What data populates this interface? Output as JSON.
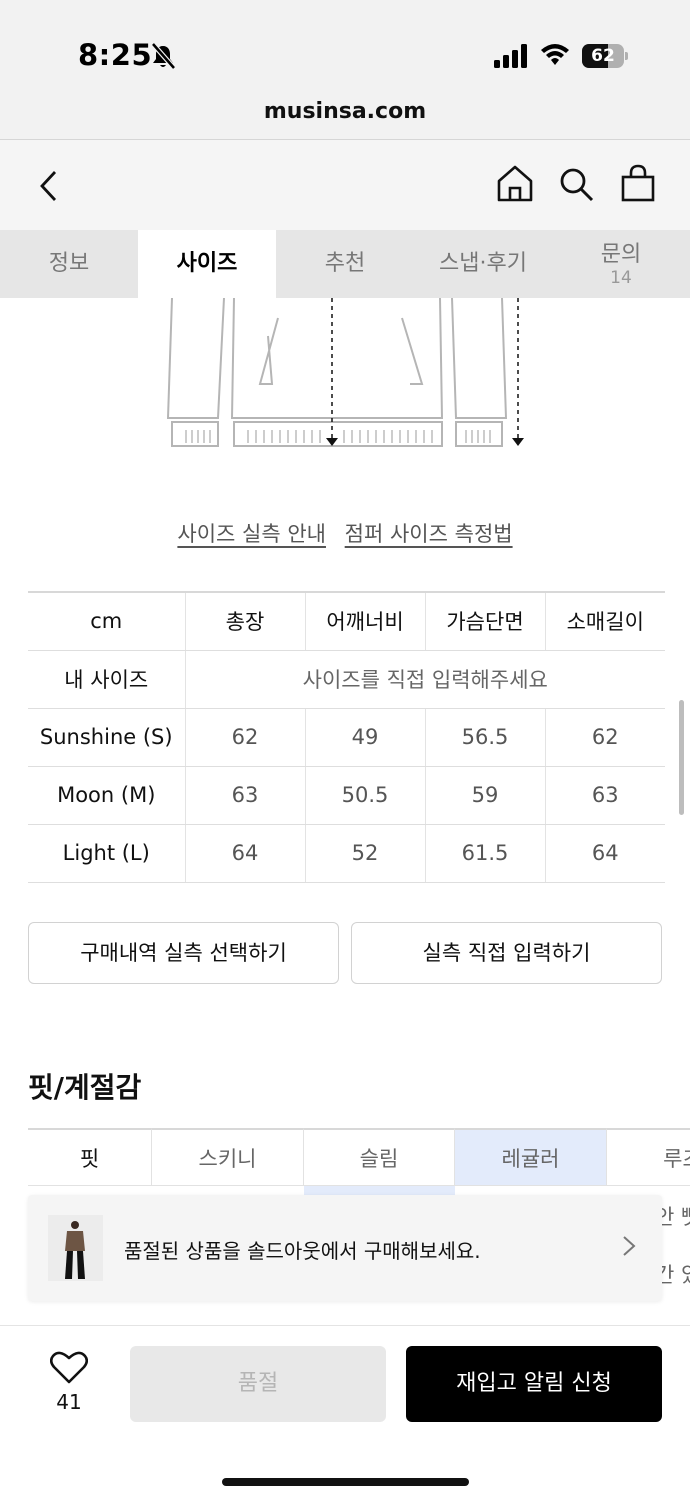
{
  "status_bar": {
    "time": "8:25",
    "battery": "62",
    "battery_level": 0.62
  },
  "browser": {
    "url": "musinsa.com"
  },
  "tabs": [
    {
      "label": "정보",
      "sub": ""
    },
    {
      "label": "사이즈",
      "sub": ""
    },
    {
      "label": "추천",
      "sub": ""
    },
    {
      "label": "스냅·후기",
      "sub": ""
    },
    {
      "label": "문의",
      "sub": "14"
    }
  ],
  "size_guide_links": [
    "사이즈 실측 안내",
    "점퍼 사이즈 측정법"
  ],
  "size_table": {
    "unit": "cm",
    "columns": [
      "총장",
      "어깨너비",
      "가슴단면",
      "소매길이"
    ],
    "my_size_label": "내 사이즈",
    "my_size_hint": "사이즈를 직접 입력해주세요",
    "rows": [
      {
        "size": "Sunshine (S)",
        "values": [
          "62",
          "49",
          "56.5",
          "62"
        ]
      },
      {
        "size": "Moon (M)",
        "values": [
          "63",
          "50.5",
          "59",
          "63"
        ]
      },
      {
        "size": "Light (L)",
        "values": [
          "64",
          "52",
          "61.5",
          "64"
        ]
      }
    ]
  },
  "buttons": {
    "purchase_history": "구매내역 실측 선택하기",
    "direct_input": "실측 직접 입력하기"
  },
  "fit_section": {
    "title": "핏/계절감",
    "row_label": "핏",
    "options": [
      "스키니",
      "슬림",
      "레귤러",
      "루즈"
    ],
    "selected": "레귤러",
    "partial_texts": [
      "안 뻣",
      "간 있"
    ]
  },
  "banner": {
    "message": "품절된 상품을 솔드아웃에서 구매해보세요."
  },
  "bottom_bar": {
    "like_count": "41",
    "soldout_label": "품절",
    "restock_label": "재입고 알림 신청"
  }
}
